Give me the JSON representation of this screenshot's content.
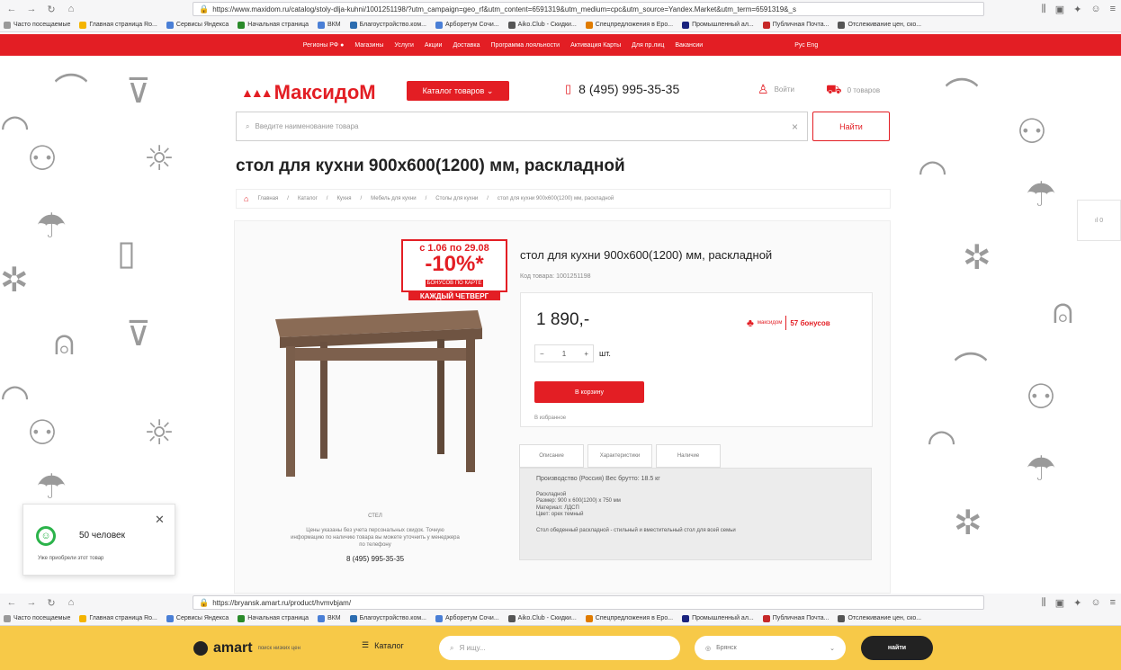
{
  "browser_top": {
    "url": "https://www.maxidom.ru/catalog/stoly-dlja-kuhni/1001251198/?utm_campaign=geo_rf&utm_content=6591319&utm_medium=cpc&utm_source=Yandex.Market&utm_term=6591319&_s",
    "bookmarks": [
      "Часто посещаемые",
      "Главная страница Ro...",
      "Сервисы Яндекса",
      "Начальная страница",
      "ВКМ",
      "Благоустройство.ком...",
      "Арборетум Сочи...",
      "Aiko.Club - Скидки...",
      "Спецпредложения в Еро...",
      "Промышленный ал...",
      "Публичная Почта...",
      "Отслеживание цен, ско..."
    ]
  },
  "topbar": {
    "items": [
      "Регионы РФ ●",
      "Магазины",
      "Услуги",
      "Акции",
      "Доставка",
      "Программа лояльности",
      "Активация Карты",
      "Для пр.лиц",
      "Вакансии"
    ],
    "lang": "Рус Eng"
  },
  "header": {
    "logo": "МаксидоМ",
    "catalog_button": "Каталог товаров ⌄",
    "phone": "8 (495) 995-35-35",
    "login": "Войти",
    "cart": "0 товаров",
    "search_placeholder": "Введите наименование товара",
    "find_button": "Найти"
  },
  "page_title": "стол для кухни 900х600(1200) мм, раскладной",
  "breadcrumbs": [
    "Главная",
    "Каталог",
    "Кухня",
    "Мебель для кухни",
    "Столы для кухни",
    "стол для кухни 900х600(1200) мм, раскладной"
  ],
  "promo": {
    "dates": "с 1.06 по 29.08",
    "percent": "-10%*",
    "bonus": "БОНУСОВ ПО КАРТЕ",
    "day": "КАЖДЫЙ ЧЕТВЕРГ"
  },
  "product": {
    "title": "стол для кухни 900х600(1200) мм, раскладной",
    "code": "Код товара: 1001251198",
    "price": "1 890,-",
    "bonus_label": "максидом",
    "bonus_count": "57 бонусов",
    "qty": "1",
    "unit": "шт.",
    "add_to_cart": "В корзину",
    "favorites": "В избранное",
    "under_image_caption": "СТЕЛ",
    "under_image_note": "Цены указаны без учета персональных скидок. Точную информацию по наличию товара вы можете уточнить у менеджера по телефону",
    "under_image_phone": "8 (495) 995-35-35"
  },
  "tabs": [
    "Описание",
    "Характеристики",
    "Наличие"
  ],
  "specs": {
    "row1": "Производство (Россия)     Вес брутто: 18.5 кг",
    "lines": [
      "Раскладной",
      "Размер: 900 x 600(1200) x 750 мм",
      "Материал: ЛДСП",
      "Цвет: орех темный"
    ],
    "desc": "Стол обеденный раскладной - стильный и вместительный стол для всей семьи"
  },
  "notification": {
    "count": "50 человек",
    "sub": "Уже приобрели этот товар"
  },
  "side_widget": "ıl 0",
  "browser_bottom": {
    "url": "https://bryansk.amart.ru/product/hvmvbjam/"
  },
  "amart": {
    "logo": "amart",
    "logo_sub": "поиск низких цен",
    "catalog": "Каталог",
    "search_placeholder": "Я ищу...",
    "city": "Брянск",
    "find": "найти"
  },
  "colors": {
    "brand_red": "#e31e24",
    "amart_yellow": "#f7c948",
    "smile_green": "#2bb34a"
  }
}
